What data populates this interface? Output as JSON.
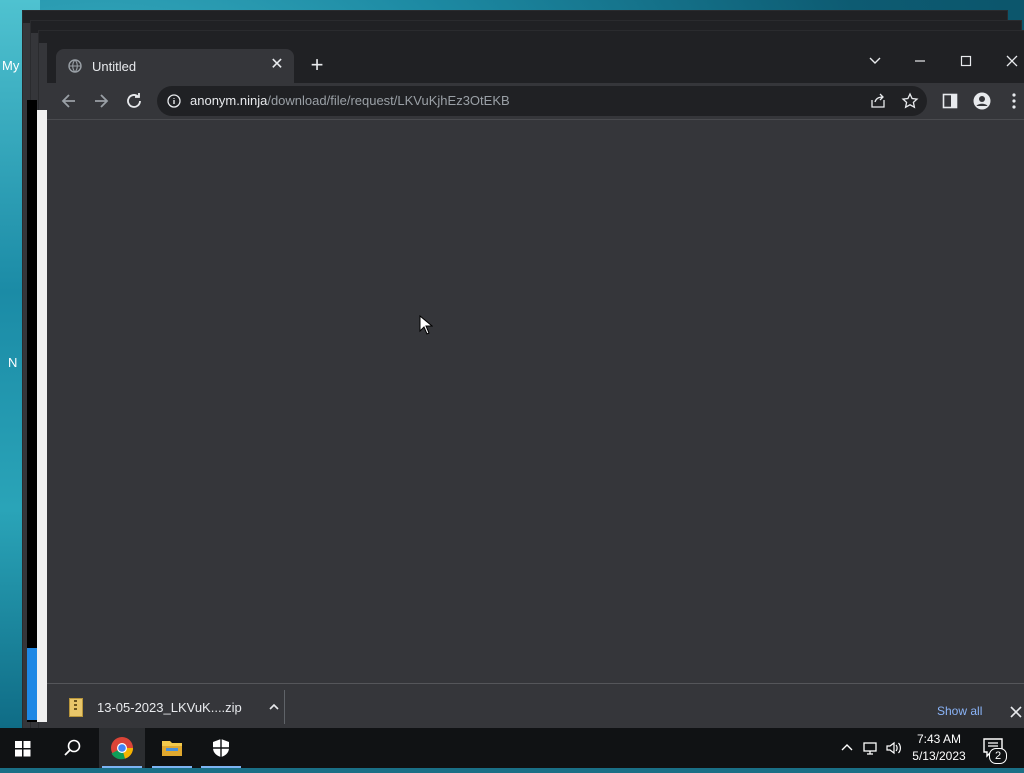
{
  "desktop": {
    "icon_label_1": "My",
    "icon_label_2": "N"
  },
  "browser": {
    "tab": {
      "title": "Untitled",
      "icon": "globe-icon"
    },
    "window_controls": {
      "tab_search": "chevron-down-icon",
      "minimize": "minimize-icon",
      "maximize": "maximize-icon",
      "close": "close-icon"
    },
    "address": {
      "host": "anonym.ninja",
      "path": "/download/file/request/LKVuKjhEz3OtEKB"
    }
  },
  "download_shelf": {
    "file_name": "13-05-2023_LKVuK....zip",
    "show_all": "Show all"
  },
  "taskbar": {
    "time": "7:43 AM",
    "date": "5/13/2023",
    "notification_count": "2"
  },
  "colors": {
    "browser_bg": "#35363a",
    "titlebar_bg": "#202124",
    "link_blue": "#8ab4f8",
    "taskbar_bg": "#101214"
  }
}
